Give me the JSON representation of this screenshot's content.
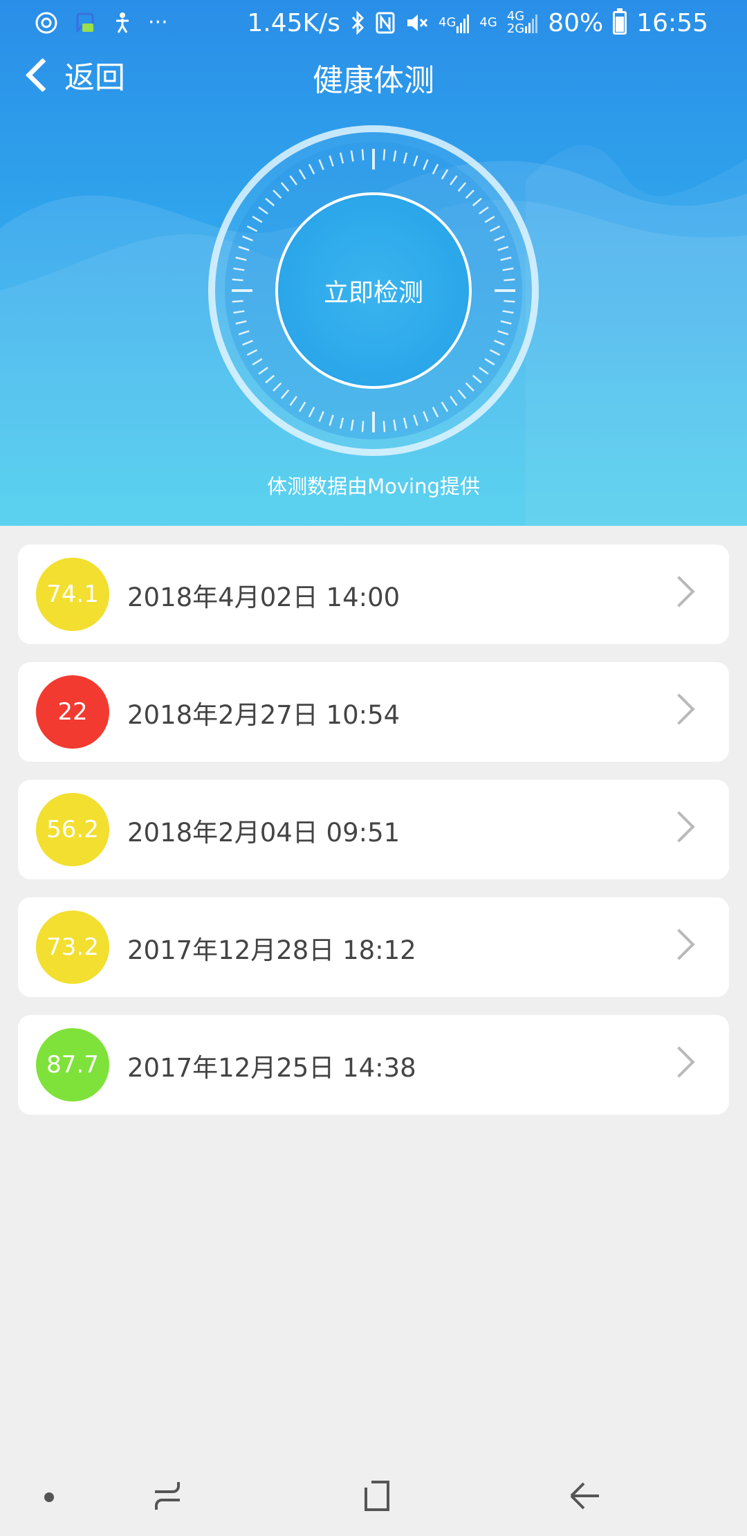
{
  "status_bar": {
    "net_speed": "1.45K/s",
    "net1": "4G",
    "net2": "4G",
    "net3_top": "4G",
    "net3_bottom": "2G",
    "battery": "80%",
    "battery_level": 0.8,
    "time": "16:55",
    "left_icons": [
      "clock-ring-icon",
      "chat-bubble-icon",
      "accessibility-icon",
      "more-dots-icon"
    ],
    "more": "···"
  },
  "nav": {
    "back_label": "返回",
    "title": "健康体测"
  },
  "hero": {
    "detect_label": "立即检测",
    "provider_text": "体测数据由Moving提供"
  },
  "records": [
    {
      "score": "74.1",
      "date": "2018年4月02日 14:00",
      "color": "#f2df2f"
    },
    {
      "score": "22",
      "date": "2018年2月27日 10:54",
      "color": "#f23a30"
    },
    {
      "score": "56.2",
      "date": "2018年2月04日 09:51",
      "color": "#f2df2f"
    },
    {
      "score": "73.2",
      "date": "2017年12月28日 18:12",
      "color": "#f2df2f"
    },
    {
      "score": "87.7",
      "date": "2017年12月25日 14:38",
      "color": "#7fe23a"
    }
  ],
  "colors": {
    "header_top": "#2a8ee8",
    "header_bottom": "#3bcaec",
    "background": "#efefef"
  }
}
